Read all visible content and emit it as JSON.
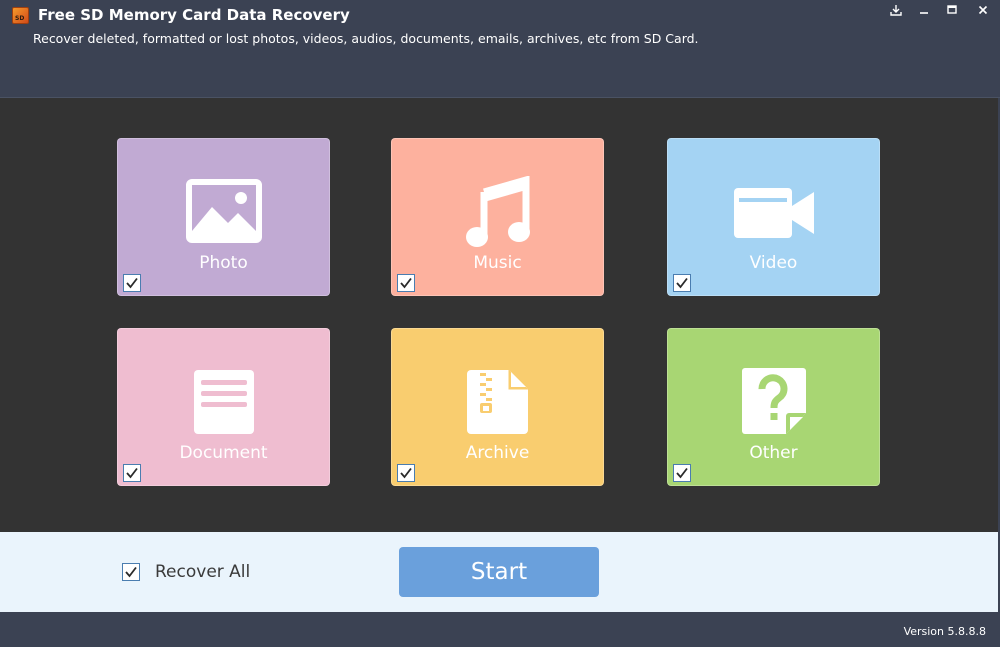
{
  "window": {
    "title": "Free SD Memory Card Data Recovery",
    "subtitle": "Recover deleted, formatted or lost photos, videos, audios, documents, emails, archives, etc from SD Card.",
    "logo_text": "SD",
    "controls": [
      {
        "name": "download-icon"
      },
      {
        "name": "minimize-icon"
      },
      {
        "name": "maximize-icon"
      },
      {
        "name": "close-icon"
      }
    ]
  },
  "categories": [
    {
      "id": "photo",
      "label": "Photo",
      "icon": "photo-icon",
      "color": "#c1aad3",
      "checked": true
    },
    {
      "id": "music",
      "label": "Music",
      "icon": "music-note-icon",
      "color": "#fdb19e",
      "checked": true
    },
    {
      "id": "video",
      "label": "Video",
      "icon": "video-camera-icon",
      "color": "#a4d3f3",
      "checked": true
    },
    {
      "id": "document",
      "label": "Document",
      "icon": "document-icon",
      "color": "#efbdd0",
      "checked": true
    },
    {
      "id": "archive",
      "label": "Archive",
      "icon": "archive-zip-icon",
      "color": "#f9cd6f",
      "checked": true
    },
    {
      "id": "other",
      "label": "Other",
      "icon": "question-file-icon",
      "color": "#a8d673",
      "checked": true
    }
  ],
  "bottom": {
    "recover_all_label": "Recover All",
    "recover_all_checked": true,
    "start_label": "Start"
  },
  "status": {
    "version": "Version 5.8.8.8"
  },
  "colors": {
    "titlebar": "#3b4253",
    "main_bg": "#333333",
    "bottom_bg": "#eaf4fc",
    "start_button": "#6aa0dc",
    "checkbox_border": "#4a7db0"
  }
}
